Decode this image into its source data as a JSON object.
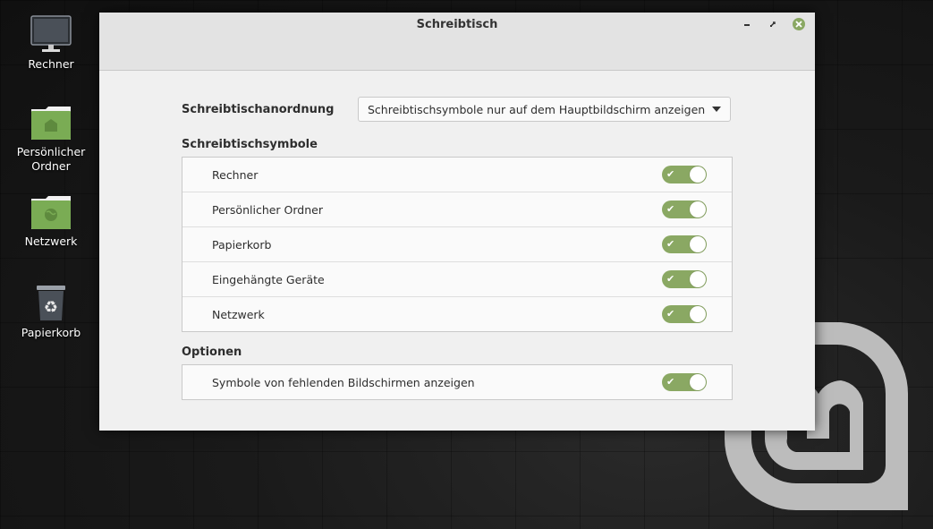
{
  "desktop": {
    "icons": [
      {
        "label": "Rechner",
        "icon": "computer-icon"
      },
      {
        "label": "Persönlicher Ordner",
        "icon": "home-folder-icon"
      },
      {
        "label": "Netzwerk",
        "icon": "network-folder-icon"
      },
      {
        "label": "Papierkorb",
        "icon": "trash-icon"
      }
    ]
  },
  "window": {
    "title": "Schreibtisch",
    "controls": {
      "minimize": "minimize-icon",
      "maximize": "maximize-icon",
      "close": "close-icon"
    }
  },
  "settings": {
    "layout_label": "Schreibtischanordnung",
    "layout_value": "Schreibtischsymbole nur auf dem Hauptbildschirm anzeigen",
    "icons_heading": "Schreibtischsymbole",
    "icons": [
      {
        "label": "Rechner",
        "enabled": true
      },
      {
        "label": "Persönlicher Ordner",
        "enabled": true
      },
      {
        "label": "Papierkorb",
        "enabled": true
      },
      {
        "label": "Eingehängte Geräte",
        "enabled": true
      },
      {
        "label": "Netzwerk",
        "enabled": true
      }
    ],
    "options_heading": "Optionen",
    "options": [
      {
        "label": "Symbole von fehlenden Bildschirmen anzeigen",
        "enabled": true
      }
    ]
  },
  "colors": {
    "accent": "#8aa863",
    "folder_green": "#7aac54"
  }
}
